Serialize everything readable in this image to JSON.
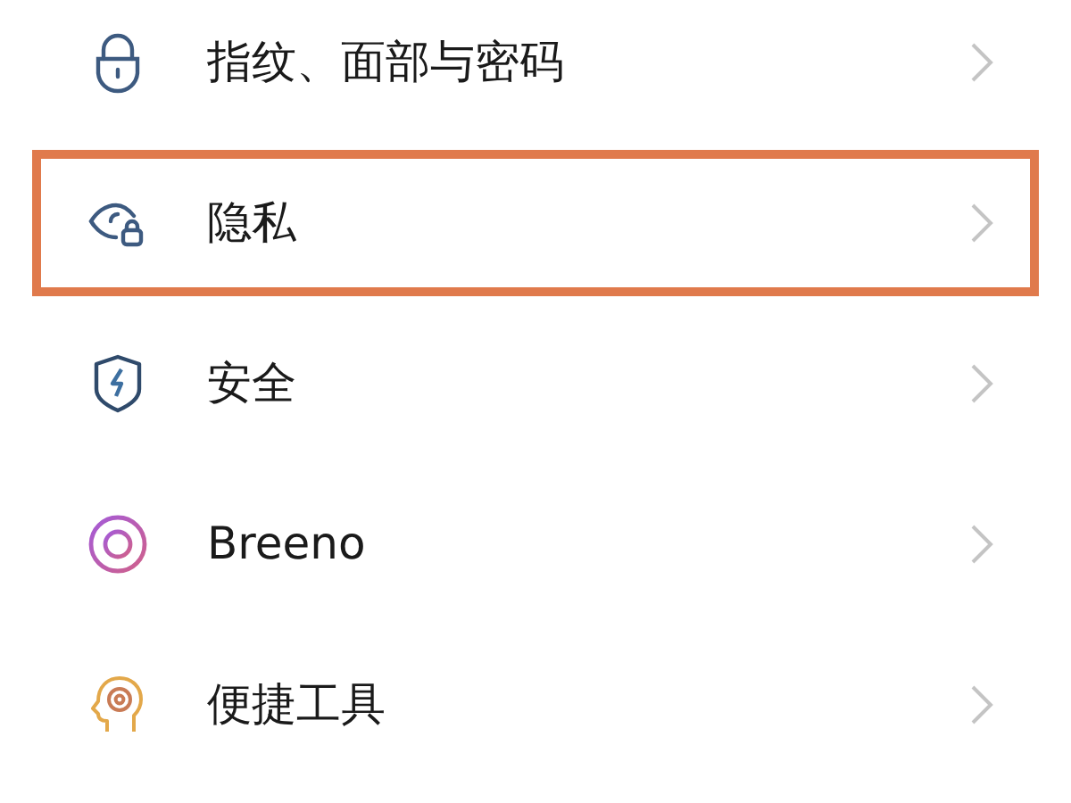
{
  "settings_items": [
    {
      "kind": "lock",
      "label": "指纹、面部与密码",
      "highlighted": false
    },
    {
      "kind": "privacy",
      "label": "隐私",
      "highlighted": true
    },
    {
      "kind": "security",
      "label": "安全",
      "highlighted": false
    },
    {
      "kind": "breeno",
      "label": "Breeno",
      "highlighted": false
    },
    {
      "kind": "tools",
      "label": "便捷工具",
      "highlighted": false
    }
  ]
}
